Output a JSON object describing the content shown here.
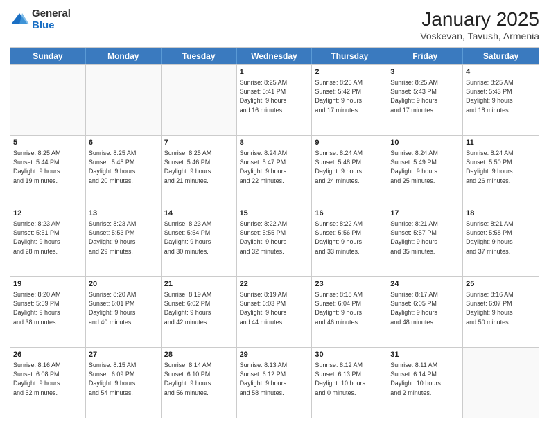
{
  "header": {
    "logo_general": "General",
    "logo_blue": "Blue",
    "month_title": "January 2025",
    "subtitle": "Voskevan, Tavush, Armenia"
  },
  "weekdays": [
    "Sunday",
    "Monday",
    "Tuesday",
    "Wednesday",
    "Thursday",
    "Friday",
    "Saturday"
  ],
  "weeks": [
    [
      {
        "day": "",
        "info": ""
      },
      {
        "day": "",
        "info": ""
      },
      {
        "day": "",
        "info": ""
      },
      {
        "day": "1",
        "info": "Sunrise: 8:25 AM\nSunset: 5:41 PM\nDaylight: 9 hours\nand 16 minutes."
      },
      {
        "day": "2",
        "info": "Sunrise: 8:25 AM\nSunset: 5:42 PM\nDaylight: 9 hours\nand 17 minutes."
      },
      {
        "day": "3",
        "info": "Sunrise: 8:25 AM\nSunset: 5:43 PM\nDaylight: 9 hours\nand 17 minutes."
      },
      {
        "day": "4",
        "info": "Sunrise: 8:25 AM\nSunset: 5:43 PM\nDaylight: 9 hours\nand 18 minutes."
      }
    ],
    [
      {
        "day": "5",
        "info": "Sunrise: 8:25 AM\nSunset: 5:44 PM\nDaylight: 9 hours\nand 19 minutes."
      },
      {
        "day": "6",
        "info": "Sunrise: 8:25 AM\nSunset: 5:45 PM\nDaylight: 9 hours\nand 20 minutes."
      },
      {
        "day": "7",
        "info": "Sunrise: 8:25 AM\nSunset: 5:46 PM\nDaylight: 9 hours\nand 21 minutes."
      },
      {
        "day": "8",
        "info": "Sunrise: 8:24 AM\nSunset: 5:47 PM\nDaylight: 9 hours\nand 22 minutes."
      },
      {
        "day": "9",
        "info": "Sunrise: 8:24 AM\nSunset: 5:48 PM\nDaylight: 9 hours\nand 24 minutes."
      },
      {
        "day": "10",
        "info": "Sunrise: 8:24 AM\nSunset: 5:49 PM\nDaylight: 9 hours\nand 25 minutes."
      },
      {
        "day": "11",
        "info": "Sunrise: 8:24 AM\nSunset: 5:50 PM\nDaylight: 9 hours\nand 26 minutes."
      }
    ],
    [
      {
        "day": "12",
        "info": "Sunrise: 8:23 AM\nSunset: 5:51 PM\nDaylight: 9 hours\nand 28 minutes."
      },
      {
        "day": "13",
        "info": "Sunrise: 8:23 AM\nSunset: 5:53 PM\nDaylight: 9 hours\nand 29 minutes."
      },
      {
        "day": "14",
        "info": "Sunrise: 8:23 AM\nSunset: 5:54 PM\nDaylight: 9 hours\nand 30 minutes."
      },
      {
        "day": "15",
        "info": "Sunrise: 8:22 AM\nSunset: 5:55 PM\nDaylight: 9 hours\nand 32 minutes."
      },
      {
        "day": "16",
        "info": "Sunrise: 8:22 AM\nSunset: 5:56 PM\nDaylight: 9 hours\nand 33 minutes."
      },
      {
        "day": "17",
        "info": "Sunrise: 8:21 AM\nSunset: 5:57 PM\nDaylight: 9 hours\nand 35 minutes."
      },
      {
        "day": "18",
        "info": "Sunrise: 8:21 AM\nSunset: 5:58 PM\nDaylight: 9 hours\nand 37 minutes."
      }
    ],
    [
      {
        "day": "19",
        "info": "Sunrise: 8:20 AM\nSunset: 5:59 PM\nDaylight: 9 hours\nand 38 minutes."
      },
      {
        "day": "20",
        "info": "Sunrise: 8:20 AM\nSunset: 6:01 PM\nDaylight: 9 hours\nand 40 minutes."
      },
      {
        "day": "21",
        "info": "Sunrise: 8:19 AM\nSunset: 6:02 PM\nDaylight: 9 hours\nand 42 minutes."
      },
      {
        "day": "22",
        "info": "Sunrise: 8:19 AM\nSunset: 6:03 PM\nDaylight: 9 hours\nand 44 minutes."
      },
      {
        "day": "23",
        "info": "Sunrise: 8:18 AM\nSunset: 6:04 PM\nDaylight: 9 hours\nand 46 minutes."
      },
      {
        "day": "24",
        "info": "Sunrise: 8:17 AM\nSunset: 6:05 PM\nDaylight: 9 hours\nand 48 minutes."
      },
      {
        "day": "25",
        "info": "Sunrise: 8:16 AM\nSunset: 6:07 PM\nDaylight: 9 hours\nand 50 minutes."
      }
    ],
    [
      {
        "day": "26",
        "info": "Sunrise: 8:16 AM\nSunset: 6:08 PM\nDaylight: 9 hours\nand 52 minutes."
      },
      {
        "day": "27",
        "info": "Sunrise: 8:15 AM\nSunset: 6:09 PM\nDaylight: 9 hours\nand 54 minutes."
      },
      {
        "day": "28",
        "info": "Sunrise: 8:14 AM\nSunset: 6:10 PM\nDaylight: 9 hours\nand 56 minutes."
      },
      {
        "day": "29",
        "info": "Sunrise: 8:13 AM\nSunset: 6:12 PM\nDaylight: 9 hours\nand 58 minutes."
      },
      {
        "day": "30",
        "info": "Sunrise: 8:12 AM\nSunset: 6:13 PM\nDaylight: 10 hours\nand 0 minutes."
      },
      {
        "day": "31",
        "info": "Sunrise: 8:11 AM\nSunset: 6:14 PM\nDaylight: 10 hours\nand 2 minutes."
      },
      {
        "day": "",
        "info": ""
      }
    ]
  ]
}
